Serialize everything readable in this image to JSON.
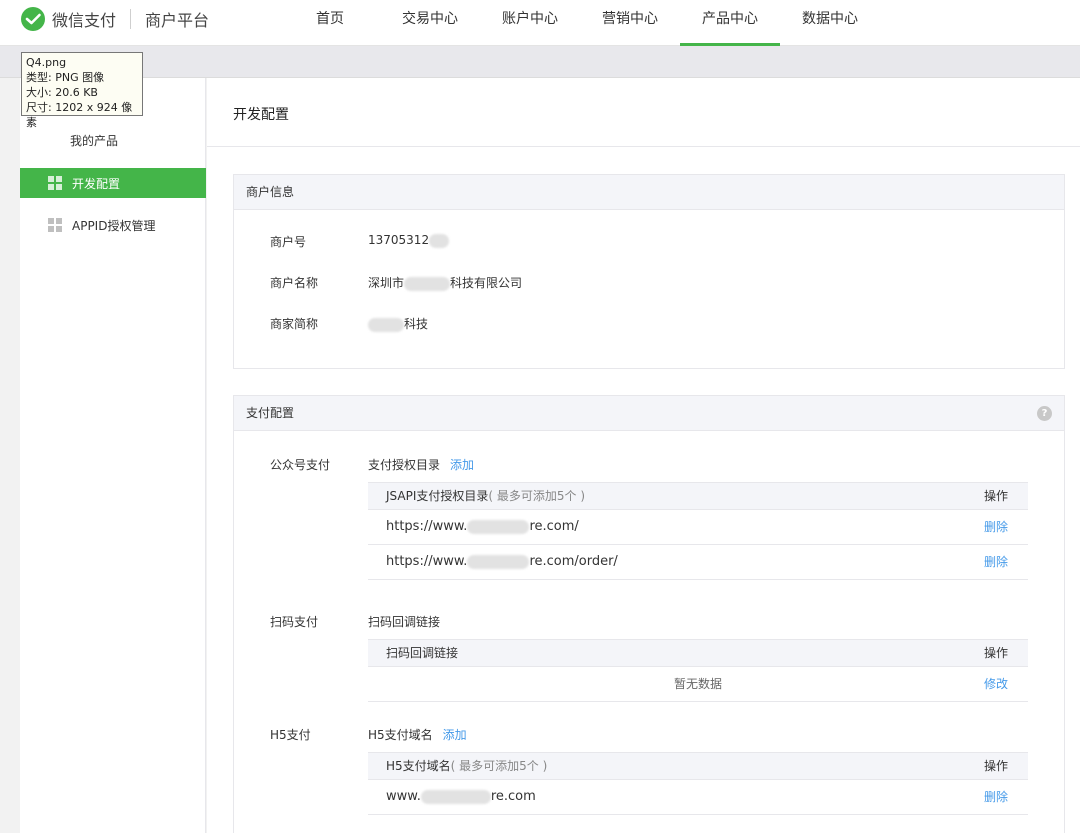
{
  "header": {
    "brand": "微信支付",
    "platform": "商户平台",
    "nav": [
      "首页",
      "交易中心",
      "账户中心",
      "营销中心",
      "产品中心",
      "数据中心"
    ],
    "active_nav": "产品中心"
  },
  "tooltip": {
    "name": "Q4.png",
    "type": "类型: PNG 图像",
    "size": "大小: 20.6 KB",
    "dims": "尺寸: 1202 x 924 像素"
  },
  "sidebar": {
    "title": "我的产品",
    "items": [
      {
        "label": "开发配置",
        "active": true
      },
      {
        "label": "APPID授权管理",
        "active": false
      }
    ]
  },
  "main": {
    "page_title": "开发配置",
    "merchant": {
      "header": "商户信息",
      "fields": [
        {
          "label": "商户号",
          "value_prefix": "13705312",
          "value_suffix": ""
        },
        {
          "label": "商户名称",
          "value_prefix": "深圳市",
          "value_suffix": "科技有限公司"
        },
        {
          "label": "商家简称",
          "value_prefix": "",
          "value_suffix": "科技"
        }
      ]
    },
    "payment": {
      "header": "支付配置",
      "help_icon": "?",
      "jsapi": {
        "label": "公众号支付",
        "title": "支付授权目录",
        "add": "添加",
        "col": "JSAPI支付授权目录",
        "note": "( 最多可添加5个 )",
        "op": "操作",
        "rows": [
          {
            "prefix": "https://www.",
            "suffix": "re.com/",
            "action": "删除"
          },
          {
            "prefix": "https://www.",
            "suffix": "re.com/order/",
            "action": "删除"
          }
        ]
      },
      "native": {
        "label": "扫码支付",
        "title": "扫码回调链接",
        "col": "扫码回调链接",
        "op": "操作",
        "empty": "暂无数据",
        "action": "修改"
      },
      "h5": {
        "label": "H5支付",
        "title": "H5支付域名",
        "add": "添加",
        "col": "H5支付域名",
        "note": "( 最多可添加5个 )",
        "op": "操作",
        "rows": [
          {
            "prefix": "www.",
            "suffix": "re.com",
            "action": "删除"
          }
        ]
      }
    }
  },
  "colors": {
    "accent": "#44b549",
    "link": "#459ae9",
    "panel_head": "#f4f5f9"
  },
  "icons": {
    "logo": "wechat-pay-logo-icon",
    "sidebar": "grid-icon",
    "help": "help-icon"
  }
}
